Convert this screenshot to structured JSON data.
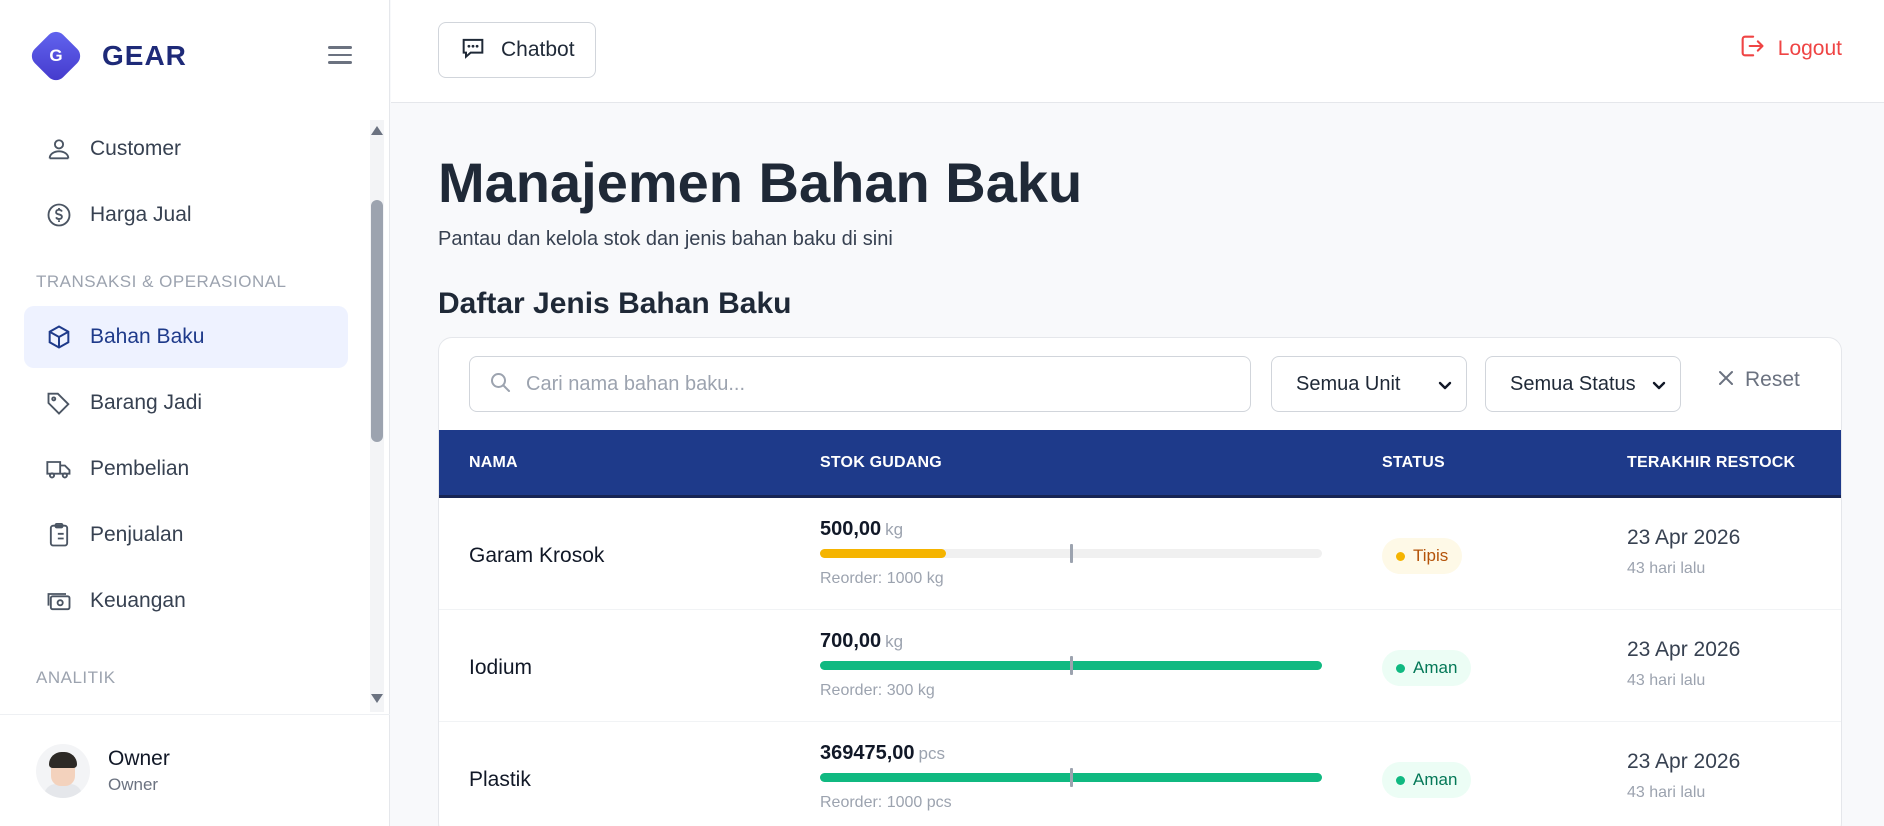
{
  "brand": {
    "logo_letter": "G",
    "name": "GEAR"
  },
  "sidebar": {
    "items": [
      {
        "label": "Customer",
        "icon": "user-icon"
      },
      {
        "label": "Harga Jual",
        "icon": "dollar-circle-icon"
      },
      {
        "label": "Bahan Baku",
        "icon": "box-icon",
        "active": true
      },
      {
        "label": "Barang Jadi",
        "icon": "tag-icon"
      },
      {
        "label": "Pembelian",
        "icon": "truck-icon"
      },
      {
        "label": "Penjualan",
        "icon": "clipboard-icon"
      },
      {
        "label": "Keuangan",
        "icon": "cash-icon"
      }
    ],
    "sections": [
      "TRANSAKSI & OPERASIONAL",
      "ANALITIK"
    ]
  },
  "user": {
    "name": "Owner",
    "role": "Owner"
  },
  "header": {
    "chatbot_label": "Chatbot",
    "logout_label": "Logout"
  },
  "page": {
    "title": "Manajemen Bahan Baku",
    "subtitle": "Pantau dan kelola stok dan jenis bahan baku di sini",
    "section_heading": "Daftar Jenis Bahan Baku"
  },
  "filters": {
    "search_placeholder": "Cari nama bahan baku...",
    "unit_selected": "Semua Unit",
    "status_selected": "Semua Status",
    "reset_label": "Reset"
  },
  "table": {
    "columns": [
      "NAMA",
      "STOK GUDANG",
      "STATUS",
      "TERAKHIR RESTOCK"
    ],
    "rows": [
      {
        "name": "Garam Krosok",
        "stock": "500,00",
        "unit": "kg",
        "stock_fill": 0.25,
        "reorder": "Reorder: 1000 kg",
        "status": "Tipis",
        "status_type": "warn",
        "restock_date": "23 Apr 2026",
        "restock_ago": "43 hari lalu"
      },
      {
        "name": "Iodium",
        "stock": "700,00",
        "unit": "kg",
        "stock_fill": 1.0,
        "reorder": "Reorder: 300 kg",
        "status": "Aman",
        "status_type": "ok",
        "restock_date": "23 Apr 2026",
        "restock_ago": "43 hari lalu"
      },
      {
        "name": "Plastik",
        "stock": "369475,00",
        "unit": "pcs",
        "stock_fill": 1.0,
        "reorder": "Reorder: 1000 pcs",
        "status": "Aman",
        "status_type": "ok",
        "restock_date": "23 Apr 2026",
        "restock_ago": "43 hari lalu"
      }
    ]
  },
  "colors": {
    "accent": "#1e3a8a",
    "warn": "#f5b400",
    "ok": "#10b981",
    "danger": "#ef4444"
  }
}
